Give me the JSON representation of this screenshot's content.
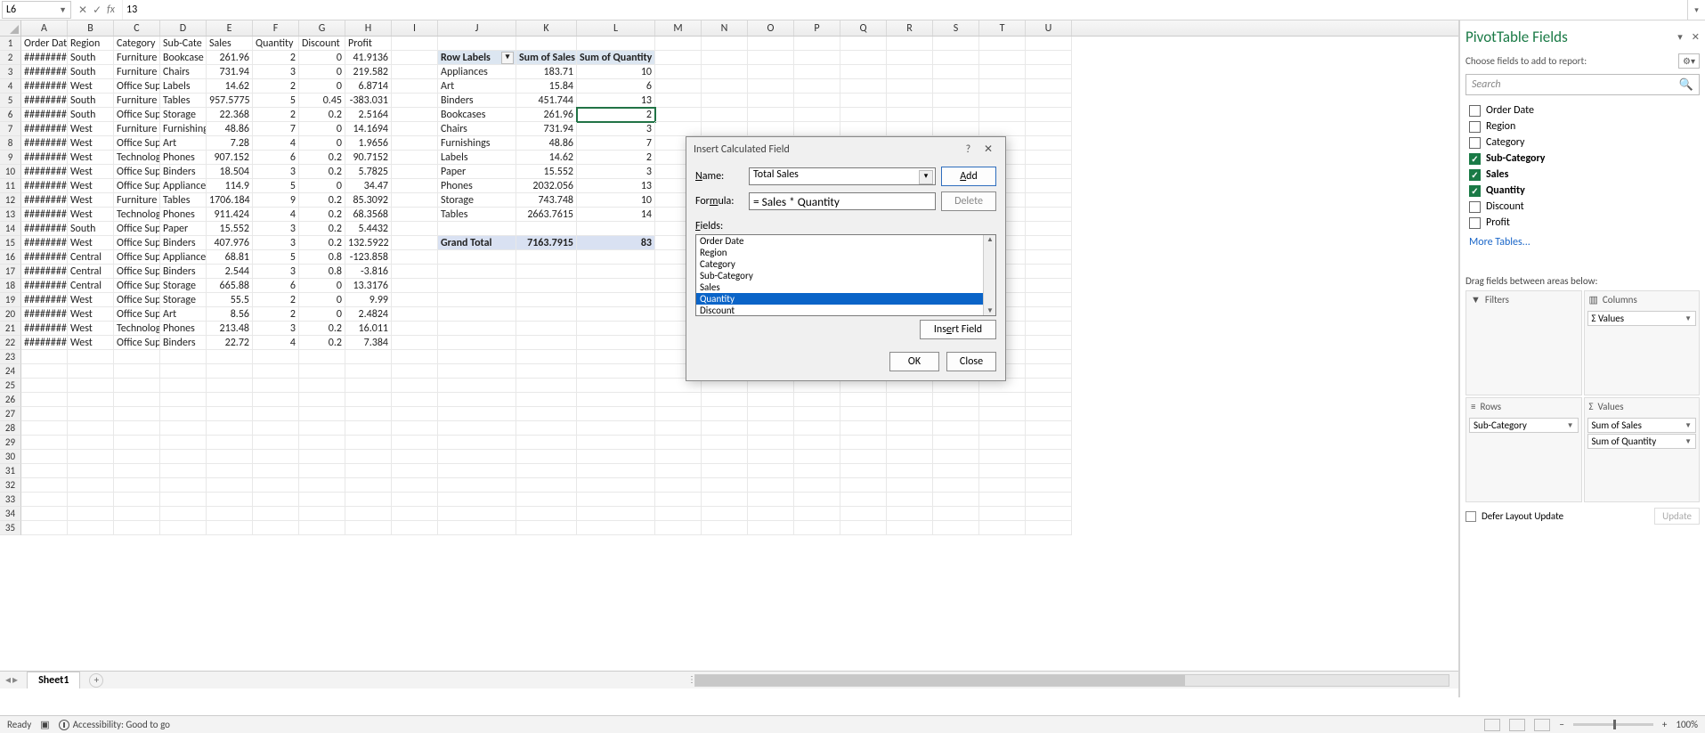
{
  "formula_bar": {
    "name_box": "L6",
    "fx_label": "fx",
    "cancel_icon": "✕",
    "enter_icon": "✓",
    "formula_value": "13"
  },
  "columns": [
    "A",
    "B",
    "C",
    "D",
    "E",
    "F",
    "G",
    "H",
    "I",
    "J",
    "K",
    "L",
    "M",
    "N",
    "O",
    "P",
    "Q",
    "R",
    "S",
    "T",
    "U"
  ],
  "row_count": 35,
  "headers": [
    "Order Dat",
    "Region",
    "Category",
    "Sub-Cate",
    "Sales",
    "Quantity",
    "Discount",
    "Profit"
  ],
  "data_rows": [
    [
      "########",
      "South",
      "Furniture",
      "Bookcase",
      "261.96",
      "2",
      "0",
      "41.9136"
    ],
    [
      "########",
      "South",
      "Furniture",
      "Chairs",
      "731.94",
      "3",
      "0",
      "219.582"
    ],
    [
      "########",
      "West",
      "Office Sup",
      "Labels",
      "14.62",
      "2",
      "0",
      "6.8714"
    ],
    [
      "########",
      "South",
      "Furniture",
      "Tables",
      "957.5775",
      "5",
      "0.45",
      "-383.031"
    ],
    [
      "########",
      "South",
      "Office Sup",
      "Storage",
      "22.368",
      "2",
      "0.2",
      "2.5164"
    ],
    [
      "########",
      "West",
      "Furniture",
      "Furnishing",
      "48.86",
      "7",
      "0",
      "14.1694"
    ],
    [
      "########",
      "West",
      "Office Sup",
      "Art",
      "7.28",
      "4",
      "0",
      "1.9656"
    ],
    [
      "########",
      "West",
      "Technolog",
      "Phones",
      "907.152",
      "6",
      "0.2",
      "90.7152"
    ],
    [
      "########",
      "West",
      "Office Sup",
      "Binders",
      "18.504",
      "3",
      "0.2",
      "5.7825"
    ],
    [
      "########",
      "West",
      "Office Sup",
      "Appliance",
      "114.9",
      "5",
      "0",
      "34.47"
    ],
    [
      "########",
      "West",
      "Furniture",
      "Tables",
      "1706.184",
      "9",
      "0.2",
      "85.3092"
    ],
    [
      "########",
      "West",
      "Technolog",
      "Phones",
      "911.424",
      "4",
      "0.2",
      "68.3568"
    ],
    [
      "########",
      "South",
      "Office Sup",
      "Paper",
      "15.552",
      "3",
      "0.2",
      "5.4432"
    ],
    [
      "########",
      "West",
      "Office Sup",
      "Binders",
      "407.976",
      "3",
      "0.2",
      "132.5922"
    ],
    [
      "########",
      "Central",
      "Office Sup",
      "Appliance",
      "68.81",
      "5",
      "0.8",
      "-123.858"
    ],
    [
      "########",
      "Central",
      "Office Sup",
      "Binders",
      "2.544",
      "3",
      "0.8",
      "-3.816"
    ],
    [
      "########",
      "Central",
      "Office Sup",
      "Storage",
      "665.88",
      "6",
      "0",
      "13.3176"
    ],
    [
      "########",
      "West",
      "Office Sup",
      "Storage",
      "55.5",
      "2",
      "0",
      "9.99"
    ],
    [
      "########",
      "West",
      "Office Sup",
      "Art",
      "8.56",
      "2",
      "0",
      "2.4824"
    ],
    [
      "########",
      "West",
      "Technolog",
      "Phones",
      "213.48",
      "3",
      "0.2",
      "16.011"
    ],
    [
      "########",
      "West",
      "Office Sup",
      "Binders",
      "22.72",
      "4",
      "0.2",
      "7.384"
    ]
  ],
  "pivot": {
    "row_labels_hdr": "Row Labels",
    "col2_hdr": "Sum of Sales",
    "col3_hdr": "Sum of Quantity",
    "rows": [
      [
        "Appliances",
        "183.71",
        "10"
      ],
      [
        "Art",
        "15.84",
        "6"
      ],
      [
        "Binders",
        "451.744",
        "13"
      ],
      [
        "Bookcases",
        "261.96",
        "2"
      ],
      [
        "Chairs",
        "731.94",
        "3"
      ],
      [
        "Furnishings",
        "48.86",
        "7"
      ],
      [
        "Labels",
        "14.62",
        "2"
      ],
      [
        "Paper",
        "15.552",
        "3"
      ],
      [
        "Phones",
        "2032.056",
        "13"
      ],
      [
        "Storage",
        "743.748",
        "10"
      ],
      [
        "Tables",
        "2663.7615",
        "14"
      ]
    ],
    "grand_total": [
      "Grand Total",
      "7163.7915",
      "83"
    ]
  },
  "dialog": {
    "title": "Insert Calculated Field",
    "help": "?",
    "close": "✕",
    "name_label": "Name:",
    "name_value": "Total Sales",
    "formula_label": "Formula:",
    "formula_value": "= Sales * Quantity",
    "add_btn": "Add",
    "delete_btn": "Delete",
    "fields_label": "Fields:",
    "fields": [
      "Order Date",
      "Region",
      "Category",
      "Sub-Category",
      "Sales",
      "Quantity",
      "Discount",
      "Profit"
    ],
    "selected_field_index": 5,
    "insert_field_btn": "Insert Field",
    "ok_btn": "OK",
    "close_btn": "Close"
  },
  "sheet_tabs": {
    "active": "Sheet1"
  },
  "field_pane": {
    "title": "PivotTable Fields",
    "subtitle": "Choose fields to add to report:",
    "search_placeholder": "Search",
    "fields": [
      {
        "name": "Order Date",
        "checked": false
      },
      {
        "name": "Region",
        "checked": false
      },
      {
        "name": "Category",
        "checked": false
      },
      {
        "name": "Sub-Category",
        "checked": true
      },
      {
        "name": "Sales",
        "checked": true
      },
      {
        "name": "Quantity",
        "checked": true
      },
      {
        "name": "Discount",
        "checked": false
      },
      {
        "name": "Profit",
        "checked": false
      }
    ],
    "more_tables": "More Tables...",
    "drag_label": "Drag fields between areas below:",
    "areas": {
      "filters": {
        "label": "Filters",
        "icon": "▼",
        "items": []
      },
      "columns": {
        "label": "Columns",
        "icon": "▥",
        "items": [
          "Σ Values"
        ]
      },
      "rows": {
        "label": "Rows",
        "icon": "≡",
        "items": [
          "Sub-Category"
        ]
      },
      "values": {
        "label": "Values",
        "icon": "Σ",
        "items": [
          "Sum of Sales",
          "Sum of Quantity"
        ]
      }
    },
    "defer_label": "Defer Layout Update",
    "update_btn": "Update"
  },
  "status": {
    "ready": "Ready",
    "accessibility": "Accessibility: Good to go",
    "zoom": "100%"
  }
}
